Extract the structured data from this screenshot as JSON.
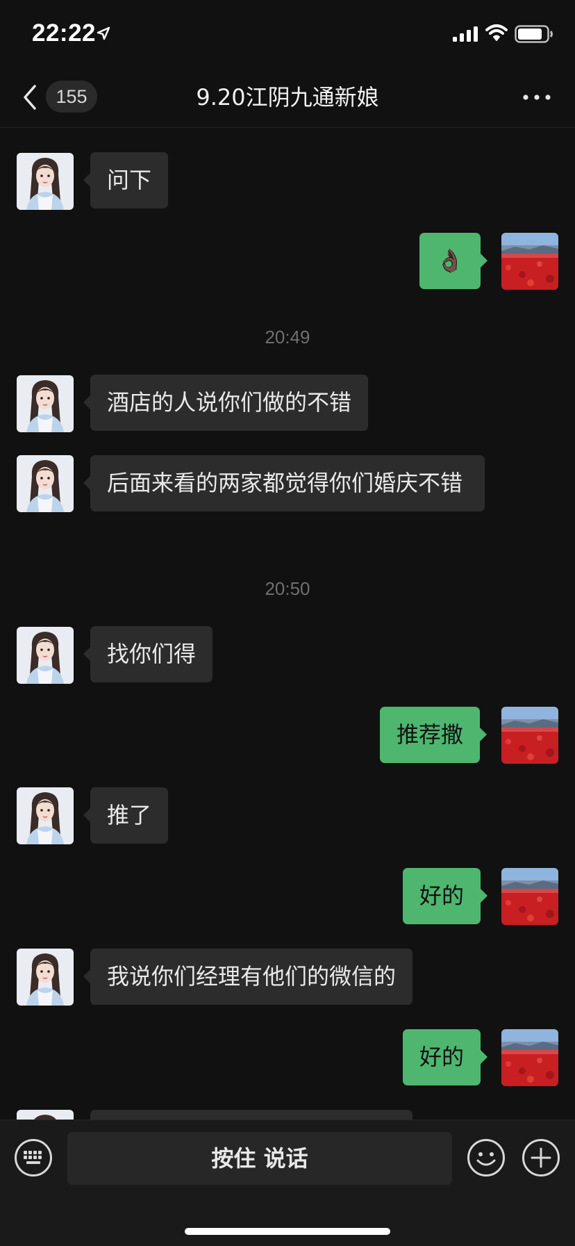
{
  "status_bar": {
    "time": "22:22",
    "battery_percent": 85
  },
  "nav": {
    "unread_count": "155",
    "title": "9.20江阴九通新娘"
  },
  "messages": [
    {
      "side": "in",
      "text": "问下"
    },
    {
      "side": "out",
      "text": "👌🏿"
    },
    {
      "timestamp": "20:49"
    },
    {
      "side": "in",
      "text": "酒店的人说你们做的不错"
    },
    {
      "side": "in",
      "text": "后面来看的两家都觉得你们婚庆不错"
    },
    {
      "timestamp": "20:50"
    },
    {
      "side": "in",
      "text": "找你们得"
    },
    {
      "side": "out",
      "text": "推荐撒"
    },
    {
      "side": "in",
      "text": "推了"
    },
    {
      "side": "out",
      "text": "好的"
    },
    {
      "side": "in",
      "text": "我说你们经理有他们的微信的"
    },
    {
      "side": "out",
      "text": "好的"
    }
  ],
  "input": {
    "hold_to_talk": "按住 说话"
  },
  "icons": {
    "back": "chevron-left-icon",
    "more": "more-dots-icon",
    "keyboard": "keyboard-icon",
    "emoji": "emoji-icon",
    "plus": "plus-icon"
  },
  "colors": {
    "background": "#111111",
    "outgoing_bubble": "#4eb66f",
    "incoming_bubble": "#2c2c2c"
  }
}
